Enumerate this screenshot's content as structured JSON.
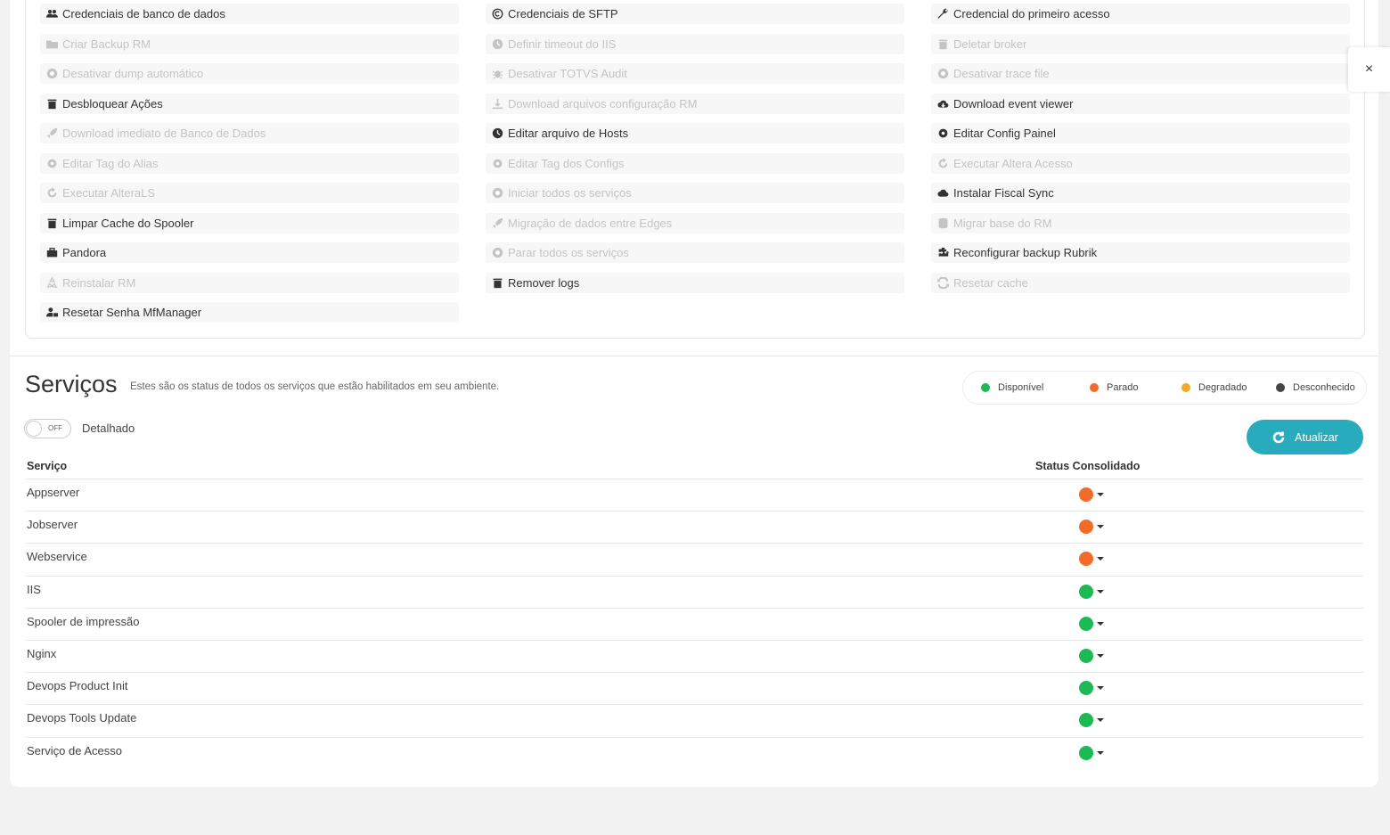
{
  "actions": {
    "col1": [
      {
        "label": "Credenciais de banco de dados",
        "icon": "users-icon",
        "enabled": true
      },
      {
        "label": "Criar Backup RM",
        "icon": "folder-icon",
        "enabled": false
      },
      {
        "label": "Desativar dump automático",
        "icon": "circle-icon",
        "enabled": false
      },
      {
        "label": "Desbloquear Ações",
        "icon": "trash-icon",
        "enabled": true
      },
      {
        "label": "Download imediato de Banco de Dados",
        "icon": "rocket-icon",
        "enabled": false
      },
      {
        "label": "Editar Tag do Alias",
        "icon": "gear-icon",
        "enabled": false
      },
      {
        "label": "Executar AlteraLS",
        "icon": "refresh-icon",
        "enabled": false
      },
      {
        "label": "Limpar Cache do Spooler",
        "icon": "trash-icon",
        "enabled": true
      },
      {
        "label": "Pandora",
        "icon": "briefcase-icon",
        "enabled": true
      },
      {
        "label": "Reinstalar RM",
        "icon": "recycle-icon",
        "enabled": false
      },
      {
        "label": "Resetar Senha MfManager",
        "icon": "user-lock-icon",
        "enabled": true
      }
    ],
    "col2": [
      {
        "label": "Credenciais de SFTP",
        "icon": "copyright-icon",
        "enabled": true
      },
      {
        "label": "Definir timeout do IIS",
        "icon": "clock-icon",
        "enabled": false
      },
      {
        "label": "Desativar TOTVS Audit",
        "icon": "bug-icon",
        "enabled": false
      },
      {
        "label": "Download arquivos configuração RM",
        "icon": "download-icon",
        "enabled": false
      },
      {
        "label": "Editar arquivo de Hosts",
        "icon": "clock-icon",
        "enabled": true
      },
      {
        "label": "Editar Tag dos Configs",
        "icon": "gear-icon",
        "enabled": false
      },
      {
        "label": "Iniciar todos os serviços",
        "icon": "circle-icon",
        "enabled": false
      },
      {
        "label": "Migração de dados entre Edges",
        "icon": "rocket-icon",
        "enabled": false
      },
      {
        "label": "Parar todos os serviços",
        "icon": "circle-icon",
        "enabled": false
      },
      {
        "label": "Remover logs",
        "icon": "trash-icon",
        "enabled": true
      }
    ],
    "col3": [
      {
        "label": "Credencial do primeiro acesso",
        "icon": "wrench-icon",
        "enabled": true
      },
      {
        "label": "Deletar broker",
        "icon": "trash-icon",
        "enabled": false
      },
      {
        "label": "Desativar trace file",
        "icon": "circle-icon",
        "enabled": false
      },
      {
        "label": "Download event viewer",
        "icon": "cloud-download-icon",
        "enabled": true
      },
      {
        "label": "Editar Config Painel",
        "icon": "gear-icon",
        "enabled": true
      },
      {
        "label": "Executar Altera Acesso",
        "icon": "refresh-icon",
        "enabled": false
      },
      {
        "label": "Instalar Fiscal Sync",
        "icon": "cloud-icon",
        "enabled": true
      },
      {
        "label": "Migrar base do RM",
        "icon": "database-icon",
        "enabled": false
      },
      {
        "label": "Reconfigurar backup Rubrik",
        "icon": "puzzle-icon",
        "enabled": true
      },
      {
        "label": "Resetar cache",
        "icon": "sync-icon",
        "enabled": false
      }
    ]
  },
  "close_label": "×",
  "services": {
    "title": "Serviços",
    "subtitle": "Estes são os status de todos os serviços que estão habilitados em seu ambiente.",
    "legend": [
      {
        "label": "Disponível",
        "color": "#1db954"
      },
      {
        "label": "Parado",
        "color": "#f26b2a"
      },
      {
        "label": "Degradado",
        "color": "#f5a623"
      },
      {
        "label": "Desconhecido",
        "color": "#444444"
      }
    ],
    "toggle_state": "OFF",
    "toggle_label": "Detalhado",
    "refresh_label": "Atualizar",
    "col_service": "Serviço",
    "col_status": "Status Consolidado",
    "rows": [
      {
        "name": "Appserver",
        "status_color": "#f26b2a"
      },
      {
        "name": "Jobserver",
        "status_color": "#f26b2a"
      },
      {
        "name": "Webservice",
        "status_color": "#f26b2a"
      },
      {
        "name": "IIS",
        "status_color": "#1db954"
      },
      {
        "name": "Spooler de impressão",
        "status_color": "#1db954"
      },
      {
        "name": "Nginx",
        "status_color": "#1db954"
      },
      {
        "name": "Devops Product Init",
        "status_color": "#1db954"
      },
      {
        "name": "Devops Tools Update",
        "status_color": "#1db954"
      },
      {
        "name": "Serviço de Acesso",
        "status_color": "#1db954"
      }
    ]
  }
}
